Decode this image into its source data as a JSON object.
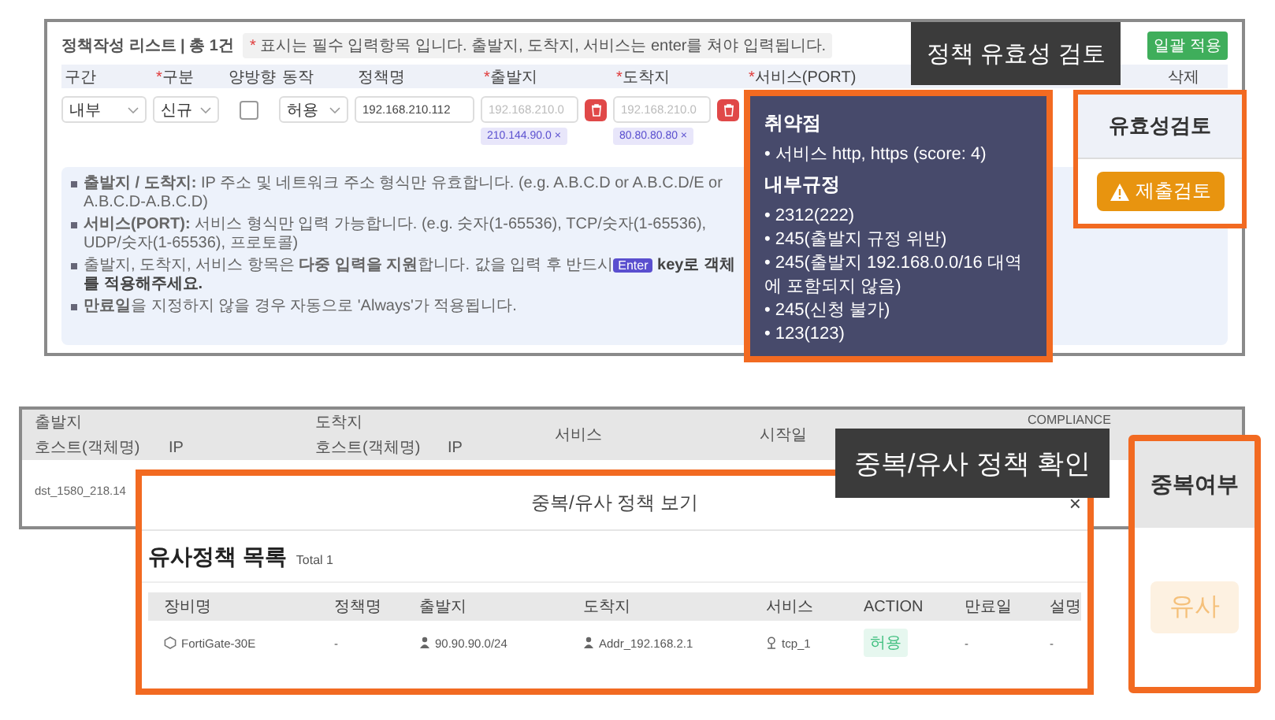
{
  "form_panel": {
    "title": "정책작성 리스트 | 총 1건",
    "hint_mark": "*",
    "hint": "표시는 필수 입력항목 입니다. 출발지, 도착지, 서비스는 enter를 쳐야 입력됩니다.",
    "apply_button": "일괄 적용",
    "columns": [
      {
        "label": "구간"
      },
      {
        "label": "구분",
        "mark": "*"
      },
      {
        "label": "양방향"
      },
      {
        "label": "동작"
      },
      {
        "label": "정책명"
      },
      {
        "label": "출발지",
        "mark": "*"
      },
      {
        "label": "도착지",
        "mark": "*"
      },
      {
        "label": "서비스(PORT)",
        "mark": "*"
      },
      {
        "label": "삭제"
      }
    ],
    "row": {
      "section": "내부",
      "type": "신규",
      "bidirectional": false,
      "action": "허용",
      "policy_name": "192.168.210.112",
      "source": {
        "placeholder": "192.168.210.0",
        "chips": [
          {
            "label": "210.144.90.0",
            "remove": "×"
          }
        ]
      },
      "destination": {
        "placeholder": "192.168.210.0",
        "chips": [
          {
            "label": "80.80.80.80",
            "remove": "×"
          }
        ]
      }
    },
    "notes": [
      {
        "text": "**출발지 / 도착지:** IP 주소 및 네트워크 주소 형식만 유효합니다. (e.g. A.B.C.D or A.B.C.D/E or A.B.C.D-A.B.C.D)"
      },
      {
        "text": "**서비스(PORT):** 서비스 형식만 입력 가능합니다. (e.g. 숫자(1-65536), TCP/숫자(1-65536), UDP/숫자(1-65536), 프로토콜)"
      },
      {
        "text": "출발지, 도착지, 서비스 항목은 **다중 입력을 지원**합니다. 값을 입력 후 반드시",
        "key": "Enter",
        "after": "key로 객체를 적용해주세요."
      },
      {
        "text": "**만료일**을 지정하지 않을 경우 자동으로 'Always'가 적용됩니다."
      }
    ]
  },
  "validity_callout": "정책 유효성 검토",
  "validity_tooltip": {
    "sections": [
      {
        "heading": "취약점",
        "items": [
          "• 서비스 http, https (score: 4)"
        ]
      },
      {
        "heading": "내부규정",
        "items": [
          "• 2312(222)",
          "• 245(출발지 규정 위반)",
          "• 245(출발지 192.168.0.0/16 대역에 포함되지 않음)",
          "• 245(신청 불가)",
          "• 123(123)"
        ]
      }
    ]
  },
  "validity_panel": {
    "header": "유효성검토",
    "button": "제출검토"
  },
  "policy_table": {
    "source": "출발지",
    "source_host": "호스트(객체명)",
    "source_ip": "IP",
    "destination": "도착지",
    "destination_host": "호스트(객체명)",
    "destination_ip": "IP",
    "service": "서비스",
    "start_date": "시작일",
    "compliance": "COMPLIANCE",
    "first_cell": "dst_1580_218.14"
  },
  "duplicate_callout": "중복/유사 정책 확인",
  "duplicate_modal": {
    "title": "중복/유사 정책 보기",
    "close": "×",
    "list_title": "유사정책 목록",
    "total": "Total 1",
    "columns": [
      "장비명",
      "정책명",
      "출발지",
      "도착지",
      "서비스",
      "ACTION",
      "만료일",
      "설명"
    ],
    "rows": [
      {
        "device": "FortiGate-30E",
        "policy": "-",
        "source": "90.90.90.0/24",
        "destination": "Addr_192.168.2.1",
        "service": "tcp_1",
        "action": "허용",
        "expiry": "-",
        "description": "-"
      }
    ]
  },
  "duplicate_panel": {
    "header": "중복여부",
    "result": "유사"
  }
}
